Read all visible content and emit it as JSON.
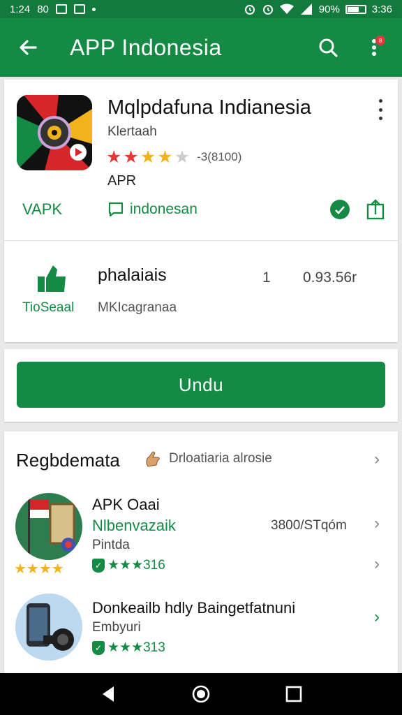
{
  "status_bar": {
    "time": "1:24",
    "carrier": "80",
    "battery": "90%",
    "clock_right": "3:36"
  },
  "app_bar": {
    "title": "APP Indonesia",
    "notification_count": "8"
  },
  "app": {
    "name": "Mqlpdafuna Indianesia",
    "developer": "Klertaah",
    "rating_count": "-3(8100)",
    "type": "APR",
    "apk_tag": "VAPK",
    "language": "indonesan"
  },
  "stats": {
    "label": "TioSeaal",
    "title": "phalaiais",
    "subtitle": "MKIcagranaa",
    "number": "1",
    "size": "0.93.56r"
  },
  "install": {
    "label": "Undu"
  },
  "recommendations": {
    "title": "Regbdemata",
    "subtitle": "Drloatiaria alrosie",
    "items": [
      {
        "name": "APK Oaai",
        "category": "Nlbenvazaik",
        "meta": "3800/STqóm",
        "subtitle": "Pintda",
        "rating_text": "★★★316"
      },
      {
        "name": "Donkeailb hdly Baingetfatnuni",
        "category": "",
        "meta": "",
        "subtitle": "Embyuri",
        "rating_text": "★★★313"
      }
    ]
  },
  "colors": {
    "primary": "#148a45",
    "status": "#127a3d",
    "star": "#f2b21b"
  }
}
